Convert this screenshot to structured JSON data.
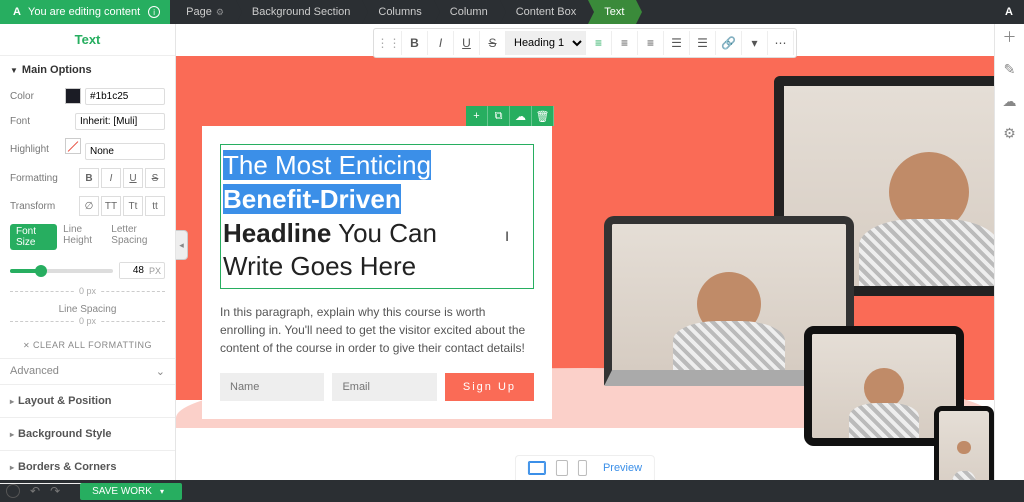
{
  "topbar": {
    "editing": "You are editing content",
    "crumbs": [
      "Page",
      "Background Section",
      "Columns",
      "Column",
      "Content Box",
      "Text"
    ]
  },
  "sidebar": {
    "title": "Text",
    "main_options": "Main Options",
    "color_label": "Color",
    "color_value": "#1b1c25",
    "font_label": "Font",
    "font_value": "Inherit: [Muli]",
    "highlight_label": "Highlight",
    "highlight_value": "None",
    "formatting_label": "Formatting",
    "fmt_buttons": [
      "B",
      "I",
      "U",
      "S"
    ],
    "transform_label": "Transform",
    "transform_buttons": [
      "∅",
      "TT",
      "Tt",
      "tt"
    ],
    "tabs": {
      "font_size": "Font Size",
      "line_height": "Line Height",
      "letter_spacing": "Letter Spacing"
    },
    "size_value": "48",
    "size_unit": "PX",
    "zero_px_a": "0 px",
    "line_spacing": "Line Spacing",
    "zero_px_b": "0 px",
    "clear_formatting": "CLEAR ALL FORMATTING",
    "advanced": "Advanced",
    "layout_position": "Layout & Position",
    "background_style": "Background Style",
    "borders_corners": "Borders & Corners"
  },
  "toolbar": {
    "heading": "Heading 1"
  },
  "content": {
    "headline_l1": "The Most Enticing",
    "headline_l2": "Benefit-Driven",
    "headline_l3a": "Headline",
    "headline_l3b": " You Can",
    "headline_l4": "Write Goes Here",
    "paragraph": "In this paragraph, explain why this course is worth enrolling in. You'll need to get the visitor excited about the content of the course in order to give their contact details!",
    "name_placeholder": "Name",
    "email_placeholder": "Email",
    "signup": "Sign Up"
  },
  "footer": {
    "save": "SAVE WORK",
    "preview": "Preview"
  }
}
